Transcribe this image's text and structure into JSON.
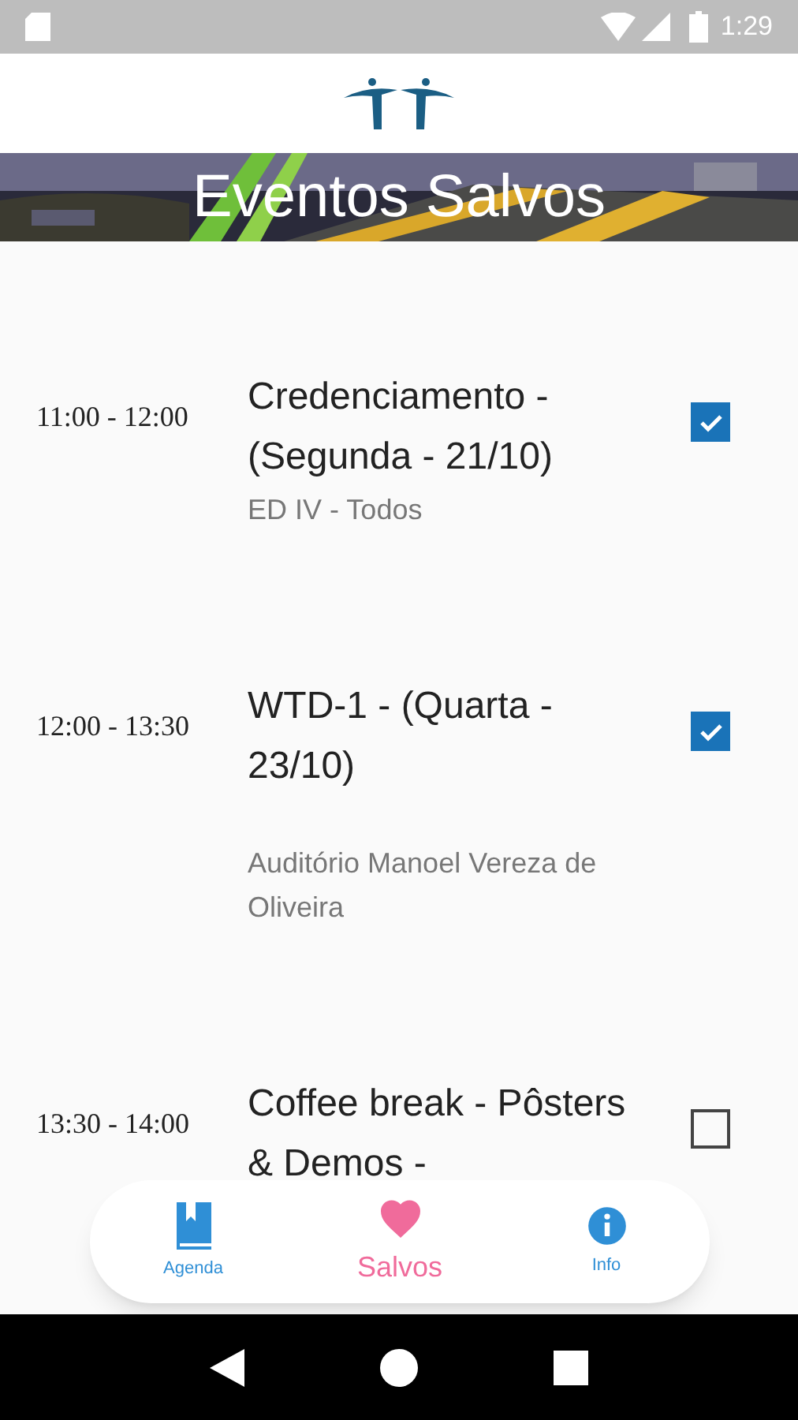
{
  "status_bar": {
    "time": "1:29"
  },
  "header": {
    "title": "Eventos Salvos"
  },
  "events": [
    {
      "time": "11:00 - 12:00",
      "title": "Credenciamento - (Segunda - 21/10)",
      "location": "ED IV - Todos",
      "checked": true
    },
    {
      "time": "12:00 - 13:30",
      "title": "WTD-1 - (Quarta - 23/10)",
      "location": "Auditório Manoel Vereza de Oliveira",
      "checked": true
    },
    {
      "time": "13:30 - 14:00",
      "title": "Coffee break - Pôsters & Demos -",
      "checked": false
    }
  ],
  "nav": [
    {
      "kind": "book",
      "label": "Agenda",
      "selected": false
    },
    {
      "kind": "heart",
      "label": "Salvos",
      "selected": true
    },
    {
      "kind": "info",
      "label": "Info",
      "selected": false
    }
  ]
}
